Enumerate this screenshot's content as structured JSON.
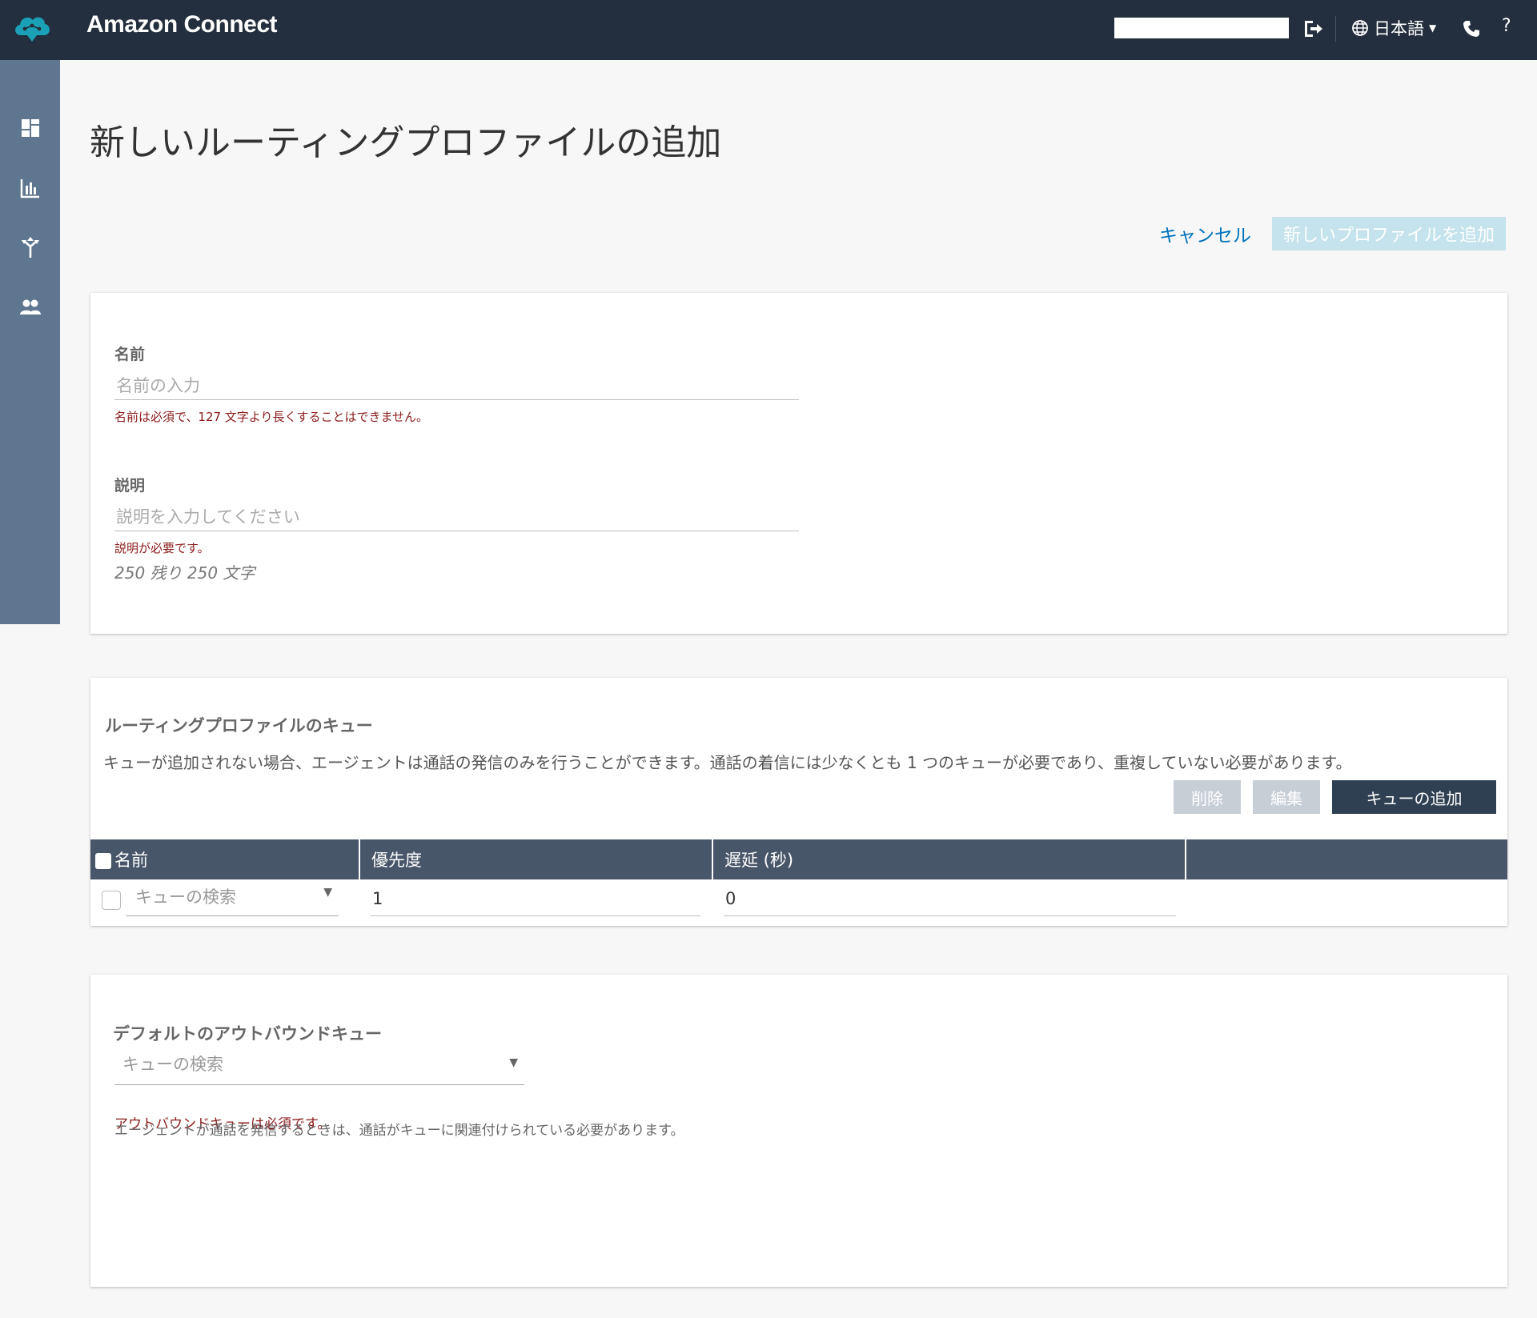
{
  "header": {
    "app_title": "Amazon Connect",
    "language": "日本語",
    "help": "?",
    "icons": [
      "connect-logo-icon",
      "logout-icon",
      "globe-icon",
      "phone-icon"
    ]
  },
  "sidebar": {
    "items": [
      {
        "icon": "dashboard-icon"
      },
      {
        "icon": "metrics-icon"
      },
      {
        "icon": "routing-icon"
      },
      {
        "icon": "users-icon"
      }
    ]
  },
  "page": {
    "title": "新しいルーティングプロファイルの追加",
    "cancel_label": "キャンセル",
    "submit_label": "新しいプロファイルを追加"
  },
  "form": {
    "name_label": "名前",
    "name_placeholder": "名前の入力",
    "name_error": "名前は必須で、127 文字より長くすることはできません。",
    "description_label": "説明",
    "description_placeholder": "説明を入力してください",
    "description_error": "説明が必要です。",
    "char_count_text": "250 残り 250 文字"
  },
  "queues": {
    "title": "ルーティングプロファイルのキュー",
    "description": "キューが追加されない場合、エージェントは通話の発信のみを行うことができます。通話の着信には少なくとも 1 つのキューが必要であり、重複していない必要があります。",
    "delete_label": "削除",
    "edit_label": "編集",
    "add_label": "キューの追加",
    "columns": [
      "名前",
      "優先度",
      "遅延 (秒)",
      ""
    ],
    "row": {
      "queue_placeholder": "キューの検索",
      "priority": "1",
      "delay": "0"
    }
  },
  "outbound": {
    "label": "デフォルトのアウトバウンドキュー",
    "placeholder": "キューの検索",
    "error": "アウトバウンドキューは必須です。",
    "note": "エージェントが通話を発信するときは、通話がキューに関連付けられている必要があります。"
  },
  "colors": {
    "topbar": "#232f3e",
    "sidebar": "#5f7691",
    "link": "#0073bb",
    "table_header": "#475669",
    "primary_button": "#2f4052",
    "disabled_button": "#c4e3ec",
    "error": "#8b1a1a"
  }
}
